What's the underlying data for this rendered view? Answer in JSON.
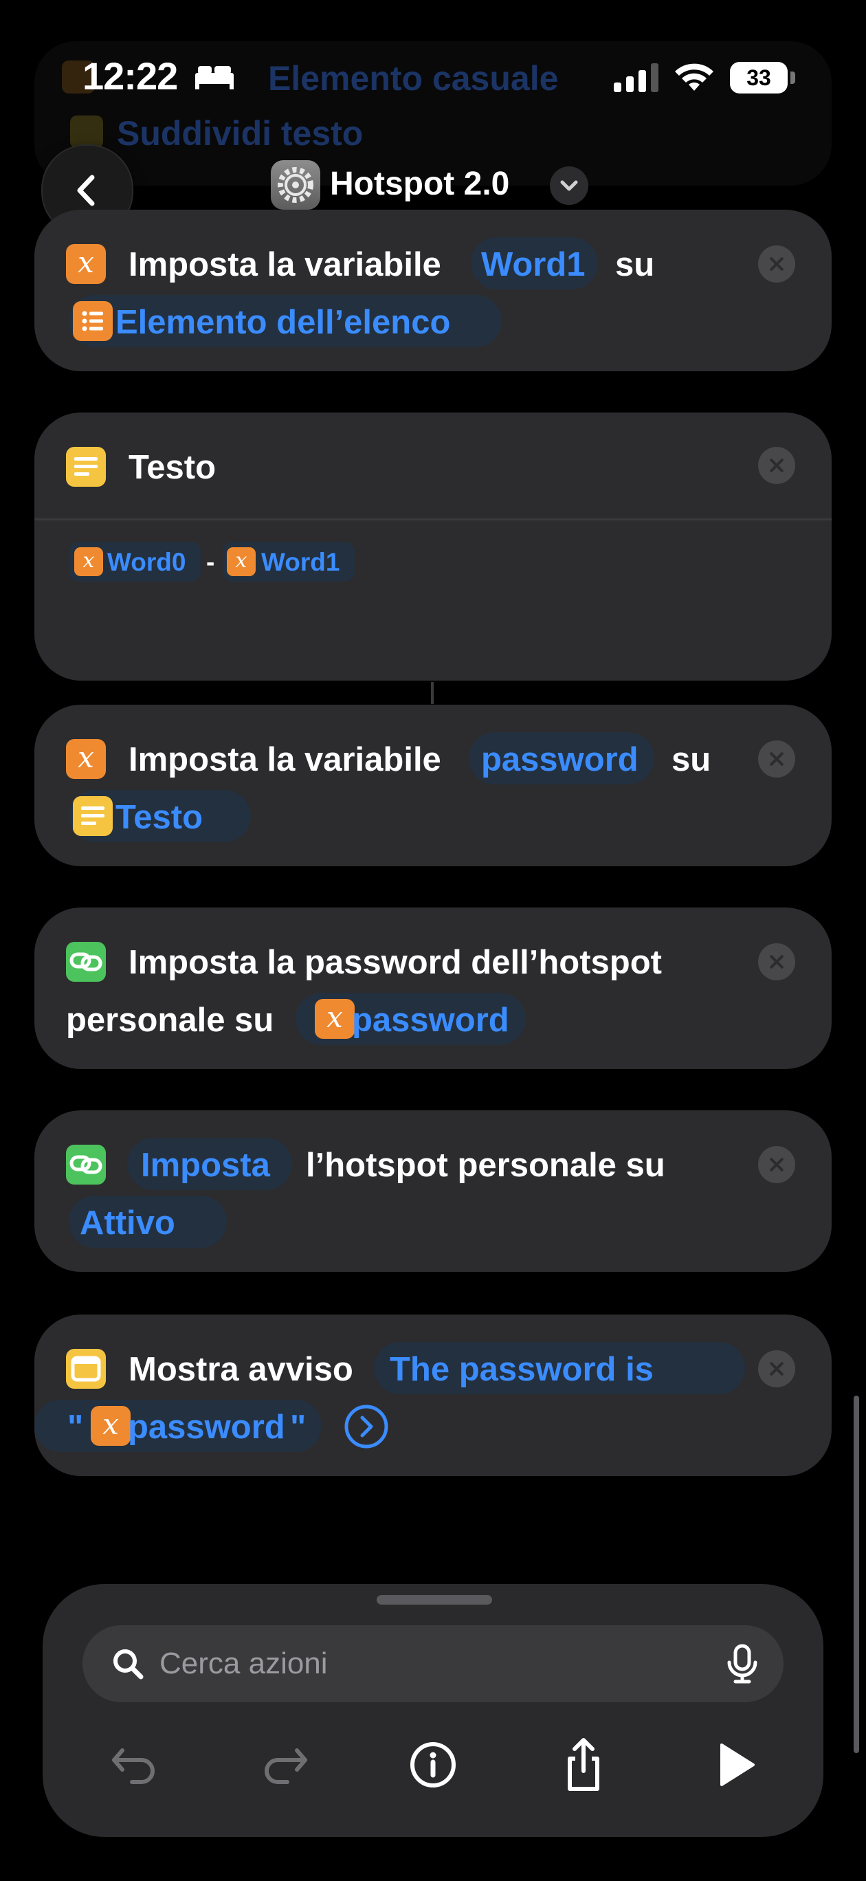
{
  "status_bar": {
    "time": "12:22",
    "battery": "33"
  },
  "background_ghost": {
    "line1": "Elemento casuale",
    "line2": "Suddividi testo"
  },
  "header": {
    "title": "Hotspot 2.0",
    "app_icon": "gear-icon"
  },
  "cards": {
    "set_word1": {
      "prefix": "Imposta la variabile",
      "variable": "Word1",
      "connector": "su",
      "value": "Elemento dell’elenco",
      "icon": "variable-icon",
      "value_icon": "list-icon"
    },
    "text": {
      "title": "Testo",
      "icon": "text-icon",
      "token1": "Word0",
      "separator": "-",
      "token2": "Word1"
    },
    "set_password": {
      "prefix": "Imposta la variabile",
      "variable": "password",
      "connector": "su",
      "value": "Testo",
      "icon": "variable-icon",
      "value_icon": "text-icon"
    },
    "hotspot_password": {
      "line1": "Imposta la password dell’hotspot",
      "line2": "personale su",
      "value": "password",
      "icon": "link-icon"
    },
    "hotspot_state": {
      "verb": "Imposta",
      "rest": "l’hotspot personale su",
      "value": "Attivo",
      "icon": "link-icon"
    },
    "alert": {
      "prefix": "Mostra avviso",
      "message_start": "The password is",
      "quote_open": "\"",
      "variable": "password",
      "quote_close": "\"",
      "icon": "alert-icon",
      "expand_icon": "chevron-right-circle-icon"
    }
  },
  "bottom_bar": {
    "search_placeholder": "Cerca azioni",
    "search_icon": "search-icon",
    "mic_icon": "microphone-icon",
    "toolbar": [
      "undo-icon",
      "redo-icon",
      "info-icon",
      "share-icon",
      "play-icon"
    ]
  },
  "colors": {
    "background": "#000000",
    "card": "#2c2c2e",
    "accent_blue": "#3b8cff",
    "variable_orange": "#f08a30",
    "text_yellow": "#f5c542",
    "hotspot_green": "#4cc35c"
  }
}
